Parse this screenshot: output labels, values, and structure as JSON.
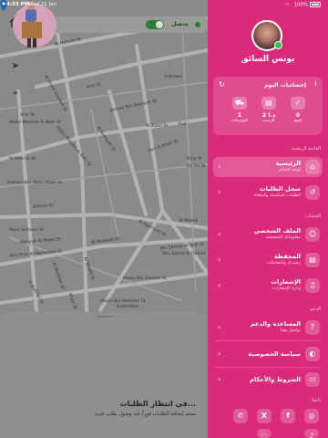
{
  "status_bar": {
    "time": "4:43 PM",
    "date": "Wed 21 Jan",
    "battery": "100%"
  },
  "map": {
    "status_label": "متصل",
    "streets": [
      "Al Nabulsi St",
      "Arar St",
      "Sulimani",
      "Ahmed Bin Seenyah St",
      "Arar St",
      "Al Sharif Hussein St",
      "Abdul Mohsen Al Bahr St",
      "Abdul Mohsen Al Bahr St",
      "Al Meerza St",
      "Al Kumiyah St",
      "Hisham Bin Abdul Malik St",
      "Fort Al Khair St",
      "Dina St",
      "Oy De St",
      "Zahran St",
      "Al Kadiriyah St",
      "Al Modeb",
      "Bin Samaa Al Sadi St",
      "Abu Salma Al Dubais",
      "Al Mutwalli St",
      "Mahyub Al Fayez St",
      "Aboo Saihoon St",
      "Abu Firas Al Hamedani St",
      "Majan Bin Zaadah St",
      "Al Waqfa St",
      "Al Bukhari St",
      "Al Baidhan St",
      "Majan Bin Khairfan St",
      "Mujal St",
      "Kadhiddah",
      "Al Zuhri St",
      "Pub"
    ],
    "waiting_title": "في انتظار الطلبات...",
    "waiting_subtitle": "ستتم إضافة الطلبات فوراً عند وصول طلب جديد"
  },
  "drawer": {
    "driver_name": "يونس السائق",
    "stats_title": "إحصائيات اليوم",
    "stats": [
      {
        "icon": "truck-icon",
        "value": "1",
        "label": "التوصيلات"
      },
      {
        "icon": "wallet-icon",
        "value": "2 د.ا",
        "label": "الرصيد"
      },
      {
        "icon": "check-icon",
        "value": "0",
        "label": "اليوم"
      }
    ],
    "sections": {
      "main": "القائمة الرئيسية",
      "account": "الحساب",
      "support": "الدعم",
      "follow": "تابعنا"
    },
    "menu": [
      {
        "title": "الرئيسية",
        "subtitle": "لوحة التحكم",
        "icon": "home-icon",
        "active": true
      },
      {
        "title": "سجل الطلبات",
        "subtitle": "الطلبات المكتملة والملغاة",
        "icon": "history-icon",
        "active": false
      },
      {
        "title": "الملف الشخصي",
        "subtitle": "معلوماتك الشخصية",
        "icon": "user-icon",
        "active": false
      },
      {
        "title": "المحفظة",
        "subtitle": "رصيدك والمعاملات",
        "icon": "wallet-icon",
        "active": false
      },
      {
        "title": "الإشعارات",
        "subtitle": "إدارة الإشعارات",
        "icon": "bell-icon",
        "active": false
      },
      {
        "title": "المساعدة والدعم",
        "subtitle": "تواصل معنا",
        "icon": "help-icon",
        "active": false
      },
      {
        "title": "سياسة الخصوصية",
        "subtitle": "",
        "icon": "shield-icon",
        "active": false
      },
      {
        "title": "الشروط والأحكام",
        "subtitle": "",
        "icon": "document-icon",
        "active": false
      }
    ],
    "social": [
      {
        "icon": "instagram-icon",
        "glyph": "◎"
      },
      {
        "icon": "facebook-icon",
        "glyph": "f"
      },
      {
        "icon": "x-icon",
        "glyph": "X"
      },
      {
        "icon": "whatsapp-icon",
        "glyph": "✆"
      },
      {
        "icon": "tiktok-icon",
        "glyph": "♪"
      },
      {
        "icon": "snapchat-icon",
        "glyph": "◌"
      }
    ],
    "colors": {
      "drawer_bg": "#db2a7a",
      "online": "#27c44a"
    }
  }
}
